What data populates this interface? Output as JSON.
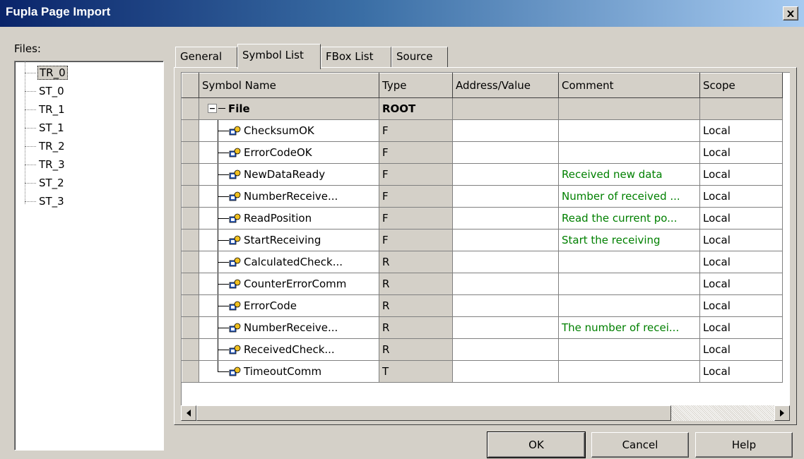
{
  "window": {
    "title": "Fupla Page Import"
  },
  "files": {
    "label": "Files:",
    "items": [
      "TR_0",
      "ST_0",
      "TR_1",
      "ST_1",
      "TR_2",
      "TR_3",
      "ST_2",
      "ST_3"
    ],
    "selected": "TR_0"
  },
  "tabs": [
    "General",
    "Symbol List",
    "FBox List",
    "Source"
  ],
  "active_tab": "Symbol List",
  "table": {
    "columns": [
      "Symbol Name",
      "Type",
      "Address/Value",
      "Comment",
      "Scope"
    ],
    "root": {
      "name": "File",
      "type": "ROOT"
    },
    "rows": [
      {
        "name": "ChecksumOK",
        "type": "F",
        "address": "",
        "comment": "",
        "scope": "Local"
      },
      {
        "name": "ErrorCodeOK",
        "type": "F",
        "address": "",
        "comment": "",
        "scope": "Local"
      },
      {
        "name": "NewDataReady",
        "type": "F",
        "address": "",
        "comment": "Received new data",
        "scope": "Local"
      },
      {
        "name": "NumberReceive...",
        "type": "F",
        "address": "",
        "comment": "Number of received ...",
        "scope": "Local"
      },
      {
        "name": "ReadPosition",
        "type": "F",
        "address": "",
        "comment": "Read the current po...",
        "scope": "Local"
      },
      {
        "name": "StartReceiving",
        "type": "F",
        "address": "",
        "comment": "Start the receiving",
        "scope": "Local"
      },
      {
        "name": "CalculatedCheck...",
        "type": "R",
        "address": "",
        "comment": "",
        "scope": "Local"
      },
      {
        "name": "CounterErrorComm",
        "type": "R",
        "address": "",
        "comment": "",
        "scope": "Local"
      },
      {
        "name": "ErrorCode",
        "type": "R",
        "address": "",
        "comment": "",
        "scope": "Local"
      },
      {
        "name": "NumberReceive...",
        "type": "R",
        "address": "",
        "comment": "The number of recei...",
        "scope": "Local"
      },
      {
        "name": "ReceivedCheck...",
        "type": "R",
        "address": "",
        "comment": "",
        "scope": "Local"
      },
      {
        "name": "TimeoutComm",
        "type": "T",
        "address": "",
        "comment": "",
        "scope": "Local"
      }
    ]
  },
  "buttons": {
    "ok": "OK",
    "cancel": "Cancel",
    "help": "Help"
  },
  "colors": {
    "comment_text": "#008000",
    "title_start": "#0a246a",
    "title_end": "#a6caf0",
    "face": "#d4d0c8"
  },
  "icons": {
    "symbol": "symbol-icon",
    "close": "close-icon",
    "collapse": "minus-box-icon"
  }
}
